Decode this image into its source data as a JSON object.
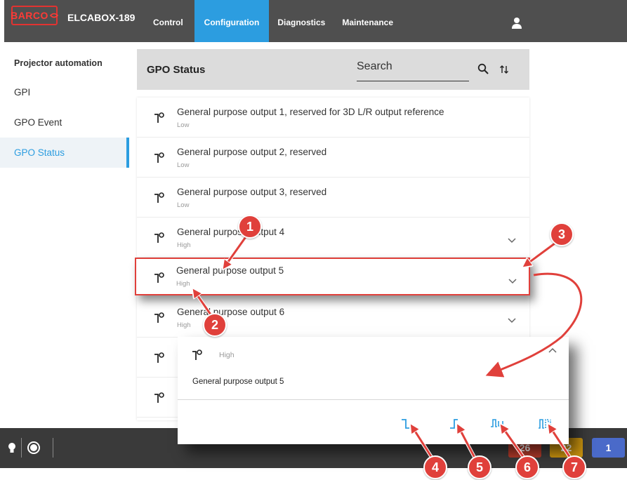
{
  "header": {
    "logo_text": "BARCO",
    "device_name": "ELCABOX-189",
    "tabs": [
      {
        "label": "Control"
      },
      {
        "label": "Configuration"
      },
      {
        "label": "Diagnostics"
      },
      {
        "label": "Maintenance"
      }
    ],
    "active_tab": "Configuration"
  },
  "sidebar": {
    "title": "Projector automation",
    "items": [
      {
        "label": "GPI"
      },
      {
        "label": "GPO Event"
      },
      {
        "label": "GPO Status"
      }
    ],
    "active_item": "GPO Status"
  },
  "main": {
    "title": "GPO Status",
    "search_placeholder": "Search"
  },
  "rows": [
    {
      "title": "General purpose output 1, reserved for 3D L/R output reference",
      "status": "Low"
    },
    {
      "title": "General purpose output 2, reserved",
      "status": "Low"
    },
    {
      "title": "General purpose output 3, reserved",
      "status": "Low"
    },
    {
      "title": "General purpose output 4",
      "status": "High"
    },
    {
      "title": "General purpose output 5",
      "status": "High"
    },
    {
      "title": "General purpose output 6",
      "status": "High"
    }
  ],
  "popup": {
    "status": "High",
    "description": "General purpose output 5",
    "actions": [
      "set-low-icon",
      "set-high-icon",
      "pulse-high-icon",
      "pulse-train-icon"
    ]
  },
  "bottombar": {
    "badges": [
      {
        "value": "26",
        "color": "#b23a2a"
      },
      {
        "value": "22",
        "color": "#c9930f"
      },
      {
        "value": "1",
        "color": "#4a6ac9"
      }
    ]
  },
  "callouts": [
    "1",
    "2",
    "3",
    "4",
    "5",
    "6",
    "7"
  ],
  "colors": {
    "accent": "#2c9de0",
    "topbar": "#4f4f4f",
    "callout": "#e0403b"
  }
}
